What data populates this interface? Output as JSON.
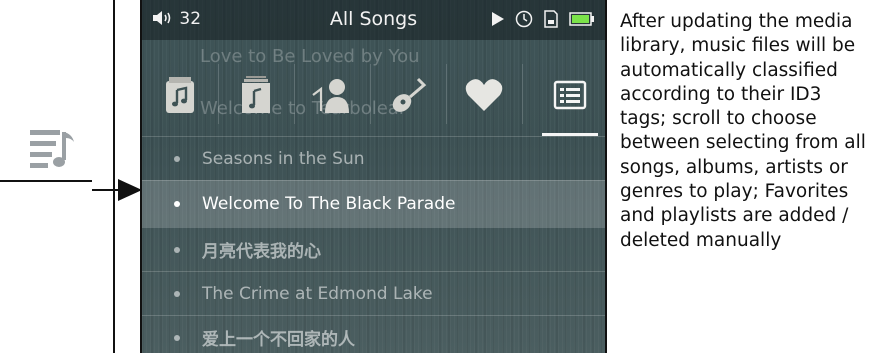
{
  "status_bar": {
    "volume": "32",
    "title": "All Songs"
  },
  "ghost_text": {
    "line1": "Love to Be Loved by You",
    "line2": "Welcome to Tearbolear"
  },
  "tabs": [
    "folder",
    "album",
    "artist",
    "genre",
    "favorites",
    "playlist"
  ],
  "songs": [
    {
      "title": "Seasons in the Sun",
      "selected": false
    },
    {
      "title": "Welcome To The Black Parade",
      "selected": true
    },
    {
      "title": "月亮代表我的心",
      "selected": false
    },
    {
      "title": "The Crime at Edmond Lake",
      "selected": false
    },
    {
      "title": "爱上一个不回家的人",
      "selected": false
    }
  ],
  "description": "After updating the media library, music files will be automatically classified according to their ID3 tags; scroll to choose between selecting from all songs, albums, artists or genres to play;  Favorites and playlists are added / deleted manually",
  "colors": {
    "screen_bg": "#3f5457",
    "battery": "#7be34a",
    "text": "#111111"
  }
}
